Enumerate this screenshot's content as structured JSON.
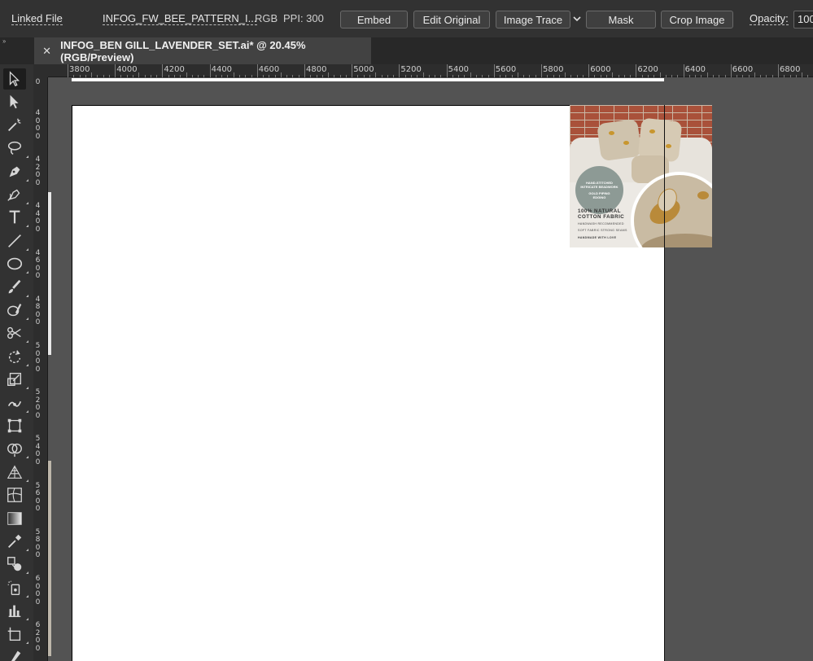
{
  "control_bar": {
    "linked_file": "Linked File",
    "file_name": "INFOG_FW_BEE_PATTERN_I...",
    "color_mode": "RGB",
    "ppi": "PPI: 300",
    "buttons": [
      "Embed",
      "Edit Original",
      "Image Trace",
      "Mask",
      "Crop Image"
    ],
    "opacity_label": "Opacity:",
    "opacity_value": "100"
  },
  "panel_grip": "››",
  "document_tab": {
    "close": "✕",
    "title": "INFOG_BEN GILL_LAVENDER_SET.ai* @ 20.45% (RGB/Preview)"
  },
  "ruler_top": [
    "3800",
    "4000",
    "4200",
    "4400",
    "4600",
    "4800",
    "5000",
    "5200",
    "5400",
    "5600",
    "5800",
    "6000",
    "6200",
    "6400",
    "6600",
    "6800"
  ],
  "ruler_left": [
    "0",
    "4000",
    "4200",
    "4400",
    "4600",
    "4800",
    "5000",
    "5200",
    "5400",
    "5600",
    "5800",
    "6000",
    "6200"
  ],
  "tools": [
    "selection-tool-icon",
    "direct-selection-tool-icon",
    "magic-wand-tool-icon",
    "lasso-tool-icon",
    "pen-tool-icon",
    "curvature-tool-icon",
    "type-tool-icon",
    "line-segment-tool-icon",
    "ellipse-tool-icon",
    "paintbrush-tool-icon",
    "shaper-tool-icon",
    "scissors-tool-icon",
    "rotate-tool-icon",
    "scale-tool-icon",
    "puppet-warp-tool-icon",
    "free-transform-tool-icon",
    "shape-builder-tool-icon",
    "perspective-grid-tool-icon",
    "mesh-tool-icon",
    "gradient-tool-icon",
    "eyedropper-tool-icon",
    "blend-tool-icon",
    "symbol-sprayer-tool-icon",
    "column-graph-tool-icon",
    "artboard-tool-icon",
    "slice-tool-icon"
  ],
  "placed_image": {
    "badge_line1": "HAND-STITCHED",
    "badge_line2": "INTRICATE BEADWORK",
    "badge_line3": "GOLD PIPING",
    "badge_line4": "EDGING",
    "headline1": "100% NATURAL",
    "headline2": "COTTON FABRIC",
    "small1": "HANDWASH RECOMMENDED",
    "small2": "SOFT FABRIC STRONG SEAMS",
    "small3": "HANDMADE WITH LOVE"
  }
}
